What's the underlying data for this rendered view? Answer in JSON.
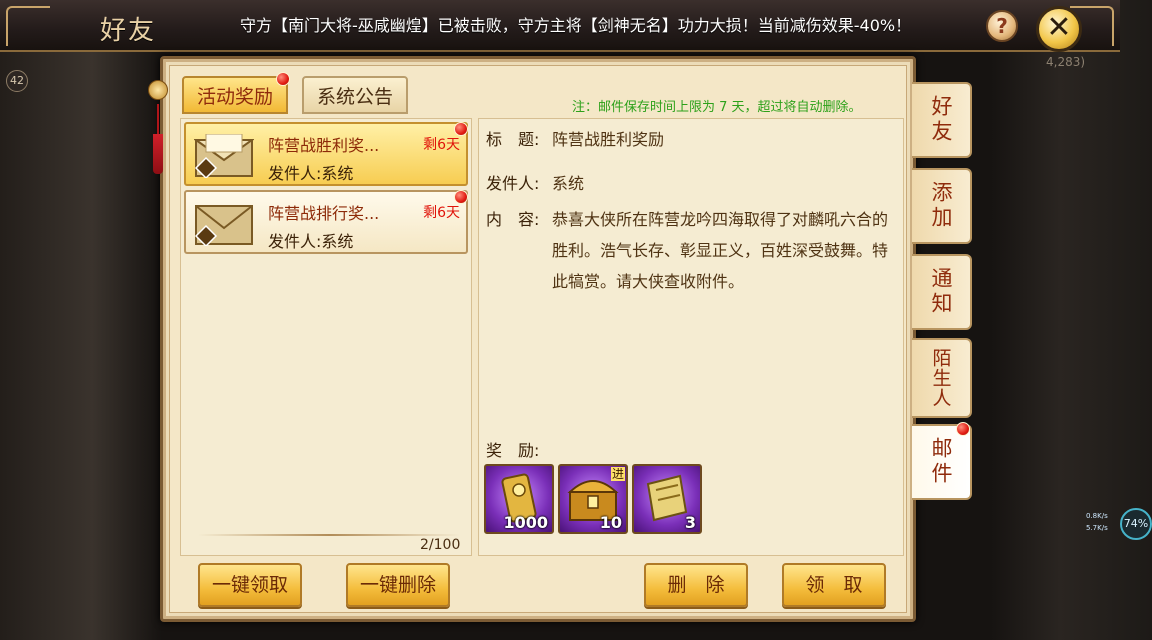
{
  "header": {
    "title": "好友",
    "marquee": "守方【南门大将-巫咸幽煌】已被击败，守方主将【剑神无名】功力大损！当前减伤效果-40%！",
    "help_label": "?",
    "close_label": "✕"
  },
  "background": {
    "level_badge": "42",
    "coords_fragment": "4,283)"
  },
  "tabs": [
    {
      "label": "活动奖励",
      "active": true,
      "has_badge": true
    },
    {
      "label": "系统公告",
      "active": false,
      "has_badge": false
    }
  ],
  "notice": "注：邮件保存时间上限为 7 天，超过将自动删除。",
  "mail_list": [
    {
      "subject": "阵营战胜利奖...",
      "sender": "发件人:系统",
      "days_left": "剩6天",
      "selected": true
    },
    {
      "subject": "阵营战排行奖...",
      "sender": "发件人:系统",
      "days_left": "剩6天",
      "selected": false
    }
  ],
  "pager": "2/100",
  "detail": {
    "title_label": "标　题:",
    "title_value": "阵营战胜利奖励",
    "sender_label": "发件人:",
    "sender_value": "系统",
    "content_label": "内　容:",
    "content_value": "恭喜大侠所在阵营龙吟四海取得了对麟吼六合的胜利。浩气长存、彰显正义，百姓深受鼓舞。特此犒赏。请大侠查收附件。",
    "rewards_label": "奖　励:"
  },
  "rewards": [
    {
      "icon": "gold-token-icon",
      "quantity": "1000",
      "tag": ""
    },
    {
      "icon": "treasure-chest-icon",
      "quantity": "10",
      "tag": "进"
    },
    {
      "icon": "scroll-icon",
      "quantity": "3",
      "tag": ""
    }
  ],
  "buttons": {
    "claim_all": "一键领取",
    "delete_all": "一键删除",
    "delete": "删　除",
    "claim": "领　取"
  },
  "side_tabs": [
    {
      "label": "好友",
      "active": false
    },
    {
      "label": "添加",
      "active": false
    },
    {
      "label": "通知",
      "active": false
    },
    {
      "label": "陌生人",
      "active": false
    },
    {
      "label": "邮件",
      "active": true
    }
  ],
  "status": {
    "net_up": "0.8K/s",
    "net_down": "5.7K/s",
    "battery": "74%"
  },
  "colors": {
    "accent_gold": "#f2b935",
    "alert_red": "#e0140a",
    "notice_green": "#2da11a",
    "reward_purple": "#7a2fb8"
  }
}
